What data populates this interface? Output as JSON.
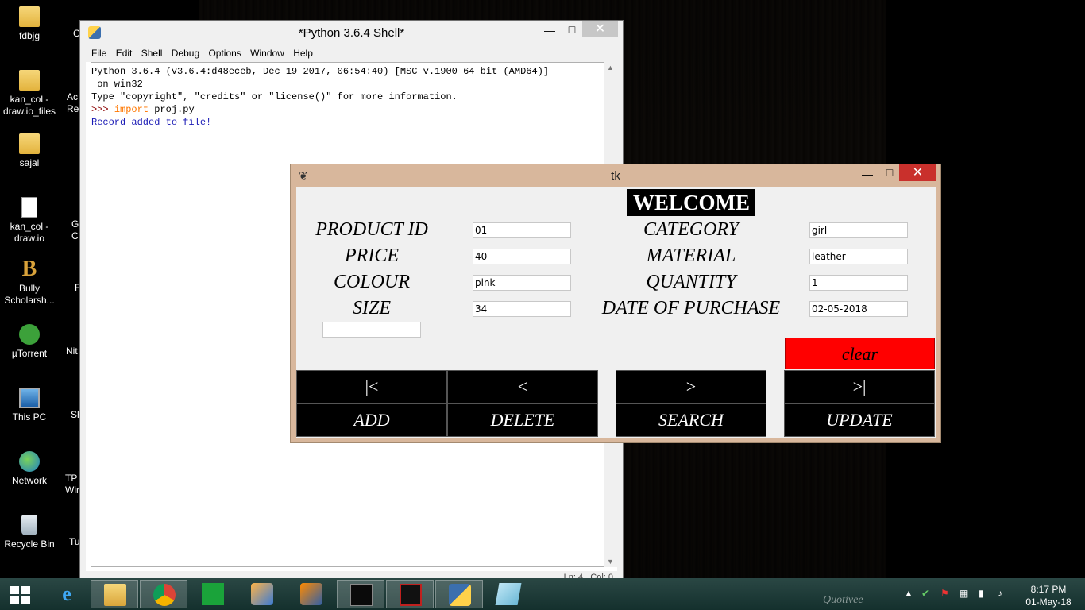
{
  "desktop": {
    "icons": [
      {
        "label": "fdbjg",
        "icon": "folder-icon"
      },
      {
        "label": "kan_col -\ndraw.io_files",
        "icon": "folder-icon"
      },
      {
        "label": "sajal",
        "icon": "folder-icon"
      },
      {
        "label": "kan_col -\ndraw.io",
        "icon": "document-icon"
      },
      {
        "label": "Bully\nScholarsh...",
        "icon": "game-icon"
      },
      {
        "label": "µTorrent",
        "icon": "utorrent-icon"
      },
      {
        "label": "This PC",
        "icon": "computer-icon"
      },
      {
        "label": "Network",
        "icon": "network-icon"
      },
      {
        "label": "Recycle Bin",
        "icon": "recycle-bin-icon"
      }
    ],
    "partial_labels": [
      "C",
      "Ac\nRea",
      "Gi\nCl",
      "F",
      "Nit",
      "Sh",
      "TP\nWire",
      "Tu"
    ]
  },
  "idle": {
    "title": "*Python 3.6.4 Shell*",
    "menu": [
      "File",
      "Edit",
      "Shell",
      "Debug",
      "Options",
      "Window",
      "Help"
    ],
    "lines": [
      "Python 3.6.4 (v3.6.4:d48eceb, Dec 19 2017, 06:54:40) [MSC v.1900 64 bit (AMD64)]",
      " on win32",
      "Type \"copyright\", \"credits\" or \"license()\" for more information."
    ],
    "prompt": ">>> ",
    "keyword": "import",
    "command": " proj.py",
    "output": "Record added to file!",
    "status": "Ln: 4   Col: 0"
  },
  "tk": {
    "title": "tk",
    "heading": "WELCOME",
    "fields": {
      "product_id": {
        "label": "PRODUCT ID",
        "value": "01"
      },
      "price": {
        "label": "PRICE",
        "value": "40"
      },
      "colour": {
        "label": "COLOUR",
        "value": "pink"
      },
      "size": {
        "label": "SIZE",
        "value": "34"
      },
      "category": {
        "label": "CATEGORY",
        "value": "girl"
      },
      "material": {
        "label": "MATERIAL",
        "value": "leather"
      },
      "quantity": {
        "label": "QUANTITY",
        "value": "1"
      },
      "date": {
        "label": "DATE OF PURCHASE",
        "value": "02-05-2018"
      }
    },
    "extra_input": "",
    "buttons": {
      "clear": "clear",
      "first": "|<",
      "prev": "<",
      "next": ">",
      "last": ">|",
      "add": "ADD",
      "delete": "DELETE",
      "search": "SEARCH",
      "update": "UPDATE"
    },
    "colors": {
      "clear_bg": "#ff0000",
      "button_bg": "#000000",
      "window_frame": "#d8b79c"
    }
  },
  "taskbar": {
    "apps": [
      "file-explorer-icon",
      "chrome-icon",
      "store-icon",
      "app-icon",
      "app-icon-2",
      "mysql-icon",
      "acrobat-icon",
      "python-icon",
      "notepad-icon"
    ],
    "watermark": "Quotivee",
    "time": "8:17 PM",
    "date": "01-May-18"
  }
}
